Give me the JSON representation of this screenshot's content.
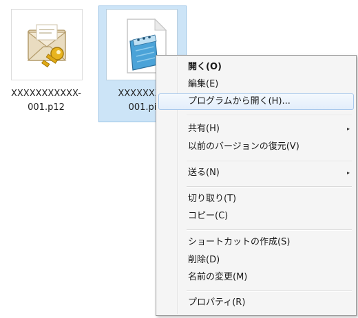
{
  "files": [
    {
      "name_line1": "XXXXXXXXXXX-",
      "name_line2": "001.p12",
      "icon": "certificate-envelope-key-icon",
      "selected": false
    },
    {
      "name_line1": "XXXXXXXX",
      "name_line2": "001.pi",
      "icon": "notepad-document-icon",
      "selected": true
    }
  ],
  "context_menu": {
    "items": [
      {
        "label": "開く(O)"
      },
      {
        "label": "編集(E)"
      },
      {
        "label": "プログラムから開く(H)..."
      },
      {
        "label": "共有(H)",
        "submenu_icon": "submenu-arrow-icon"
      },
      {
        "label": "以前のバージョンの復元(V)"
      },
      {
        "label": "送る(N)",
        "submenu_icon": "submenu-arrow-icon"
      },
      {
        "label": "切り取り(T)"
      },
      {
        "label": "コピー(C)"
      },
      {
        "label": "ショートカットの作成(S)"
      },
      {
        "label": "削除(D)"
      },
      {
        "label": "名前の変更(M)"
      },
      {
        "label": "プロパティ(R)"
      }
    ],
    "submenu_arrow": "▸"
  },
  "colors": {
    "selection_bg": "#cce4f7",
    "selection_border": "#99c3e6",
    "menu_bg": "#f5f5f5",
    "menu_hover_border": "#a8c8ec"
  }
}
